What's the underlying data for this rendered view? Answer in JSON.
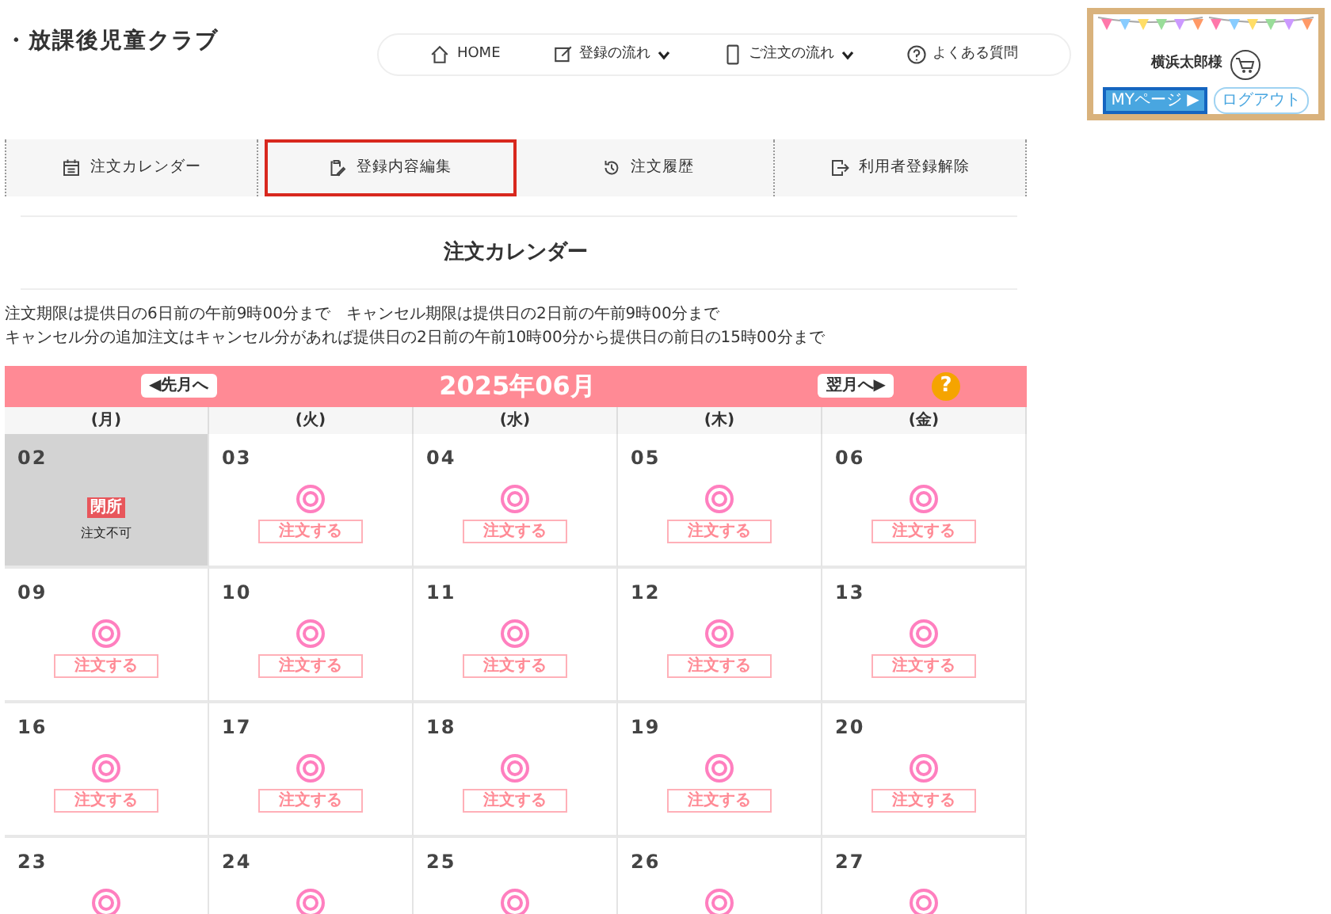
{
  "site_title": "・放課後児童クラブ",
  "nav": [
    {
      "label": "HOME",
      "dropdown": false
    },
    {
      "label": "登録の流れ",
      "dropdown": true
    },
    {
      "label": "ご注文の流れ",
      "dropdown": true
    },
    {
      "label": "よくある質問",
      "dropdown": false
    }
  ],
  "user_box": {
    "user_name": "横浜太郎様",
    "mypage_button": "MYページ ▶",
    "logout_button": "ログアウト"
  },
  "tabs": [
    {
      "label": "注文カレンダー",
      "selected": false
    },
    {
      "label": "登録内容編集",
      "selected": true
    },
    {
      "label": "注文履歴",
      "selected": false
    },
    {
      "label": "利用者登録解除",
      "selected": false
    }
  ],
  "page_title": "注文カレンダー",
  "notices": [
    "注文期限は提供日の6日前の午前9時00分まで　キャンセル期限は提供日の2日前の午前9時00分まで",
    "キャンセル分の追加注文はキャンセル分があれば提供日の2日前の午前10時00分から提供日の前日の15時00分まで"
  ],
  "calendar": {
    "prev_button": "◀先月へ",
    "month": "2025年06月",
    "next_button": "翌月へ▶",
    "help": "?",
    "weekdays": [
      "(月)",
      "(火)",
      "(水)",
      "(木)",
      "(金)"
    ],
    "weeks": [
      [
        {
          "date": "02",
          "kind": "closed",
          "badge": "閉所",
          "note": "注文不可"
        },
        {
          "date": "03",
          "kind": "order",
          "order_label": "注文する"
        },
        {
          "date": "04",
          "kind": "order",
          "order_label": "注文する"
        },
        {
          "date": "05",
          "kind": "order",
          "order_label": "注文する"
        },
        {
          "date": "06",
          "kind": "order",
          "order_label": "注文する"
        }
      ],
      [
        {
          "date": "09",
          "kind": "order",
          "order_label": "注文する"
        },
        {
          "date": "10",
          "kind": "order",
          "order_label": "注文する"
        },
        {
          "date": "11",
          "kind": "order",
          "order_label": "注文する"
        },
        {
          "date": "12",
          "kind": "order",
          "order_label": "注文する"
        },
        {
          "date": "13",
          "kind": "order",
          "order_label": "注文する"
        }
      ],
      [
        {
          "date": "16",
          "kind": "order",
          "order_label": "注文する"
        },
        {
          "date": "17",
          "kind": "order",
          "order_label": "注文する"
        },
        {
          "date": "18",
          "kind": "order",
          "order_label": "注文する"
        },
        {
          "date": "19",
          "kind": "order",
          "order_label": "注文する"
        },
        {
          "date": "20",
          "kind": "order",
          "order_label": "注文する"
        }
      ],
      [
        {
          "date": "23",
          "kind": "order"
        },
        {
          "date": "24",
          "kind": "order"
        },
        {
          "date": "25",
          "kind": "order"
        },
        {
          "date": "26",
          "kind": "order"
        },
        {
          "date": "27",
          "kind": "order"
        }
      ]
    ]
  }
}
